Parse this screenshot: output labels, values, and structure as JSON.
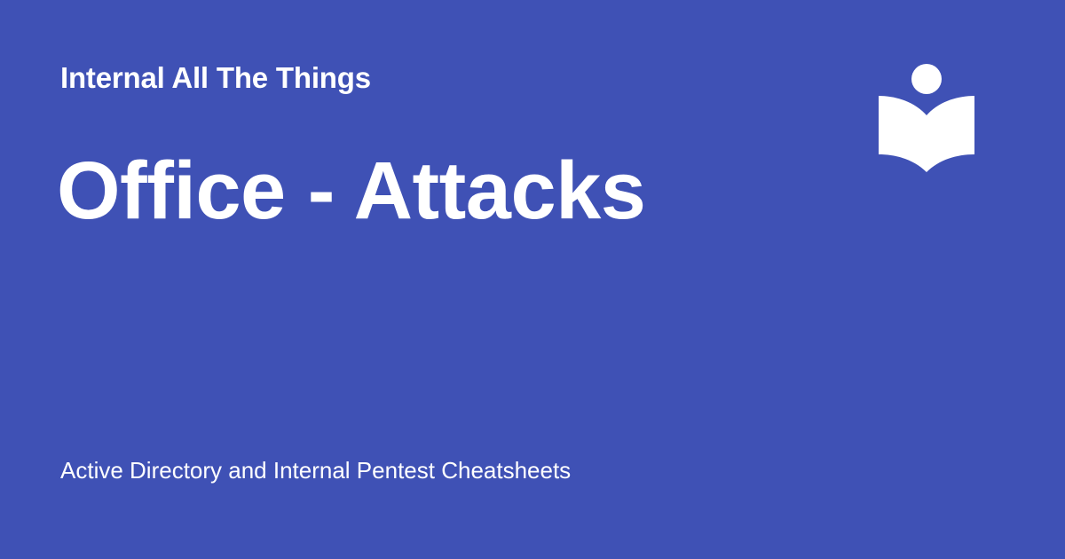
{
  "header": {
    "site_name": "Internal All The Things"
  },
  "main": {
    "title": "Office - Attacks"
  },
  "footer": {
    "tagline": "Active Directory and Internal Pentest Cheatsheets"
  },
  "logo": {
    "icon": "reader-book-icon"
  },
  "colors": {
    "background": "#3f51b5",
    "foreground": "#ffffff"
  }
}
